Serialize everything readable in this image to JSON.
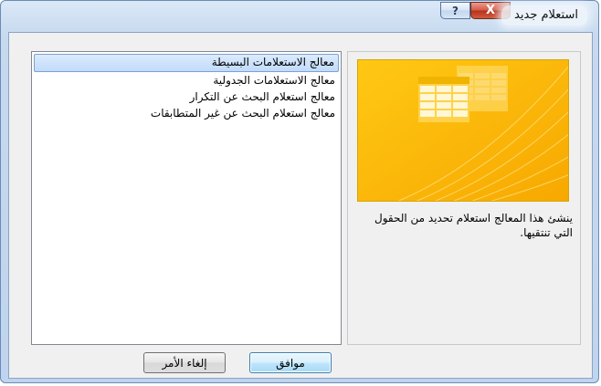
{
  "window": {
    "title": "استعلام جديد",
    "help_glyph": "?",
    "close_glyph": "X"
  },
  "wizard_list": {
    "items": [
      {
        "label": "معالج الاستعلامات البسيطة",
        "selected": true
      },
      {
        "label": "معالج الاستعلامات الجدولية",
        "selected": false
      },
      {
        "label": "معالج استعلام البحث عن التكرار",
        "selected": false
      },
      {
        "label": "معالج استعلام البحث عن غير المتطابقات",
        "selected": false
      }
    ]
  },
  "preview": {
    "image_icon": "query-wizard-illustration",
    "description": "ينشئ هذا المعالج استعلام تحديد من الحقول التي تنتقيها."
  },
  "buttons": {
    "ok": "موافق",
    "cancel": "إلغاء الأمر"
  },
  "colors": {
    "preview_bg": "#f9b800",
    "selection": "#c1dbfc",
    "close_button": "#c8402a"
  }
}
